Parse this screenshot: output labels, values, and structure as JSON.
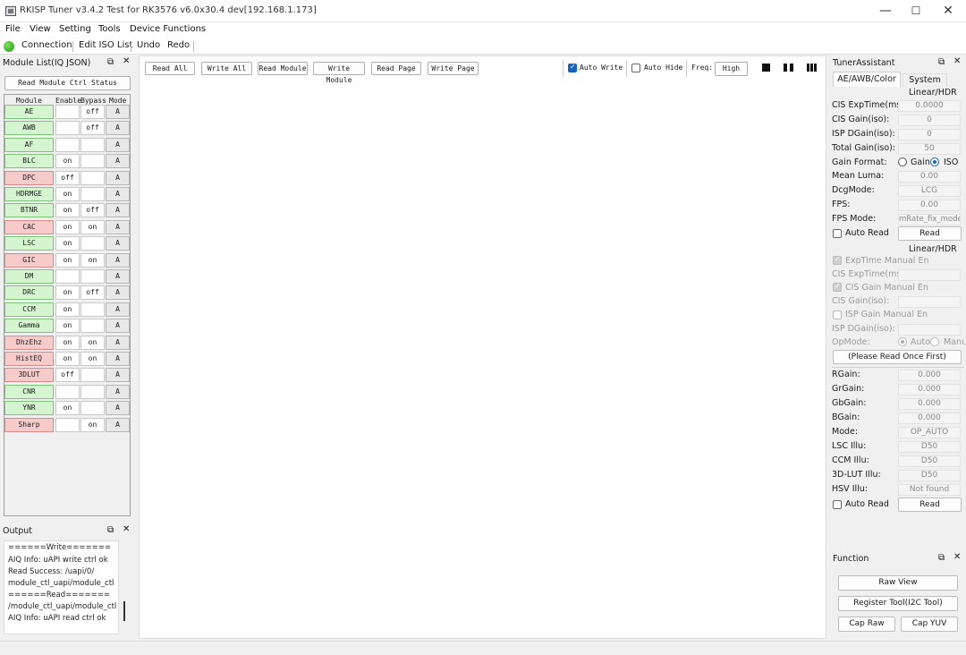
{
  "window": {
    "title": "RKISP Tuner v3.4.2 Test for RK3576 v6.0x30.4 dev[192.168.1.173]",
    "minimize": "—",
    "maximize": "☐",
    "close": "✕"
  },
  "menu": [
    "File",
    "View",
    "Setting",
    "Tools",
    "Device Functions"
  ],
  "toolbar": {
    "connection": "Connection",
    "edit_iso": "Edit ISO List",
    "undo": "Undo",
    "redo": "Redo"
  },
  "module_list": {
    "title": "Module List(IQ JSON)",
    "read_status": "Read Module Ctrl Status",
    "headers": [
      "Module",
      "Enable",
      "Bypass",
      "Mode"
    ],
    "rows": [
      {
        "name": "AE",
        "enable": "",
        "bypass": "off",
        "mode": "A",
        "status": "green"
      },
      {
        "name": "AWB",
        "enable": "",
        "bypass": "off",
        "mode": "A",
        "status": "green"
      },
      {
        "name": "AF",
        "enable": "",
        "bypass": "",
        "mode": "A",
        "status": "green"
      },
      {
        "name": "BLC",
        "enable": "on",
        "bypass": "",
        "mode": "A",
        "status": "green"
      },
      {
        "name": "DPC",
        "enable": "off",
        "bypass": "",
        "mode": "A",
        "status": "red"
      },
      {
        "name": "HDRMGE",
        "enable": "on",
        "bypass": "",
        "mode": "A",
        "status": "green"
      },
      {
        "name": "BTNR",
        "enable": "on",
        "bypass": "off",
        "mode": "A",
        "status": "green"
      },
      {
        "name": "CAC",
        "enable": "on",
        "bypass": "on",
        "mode": "A",
        "status": "red"
      },
      {
        "name": "LSC",
        "enable": "on",
        "bypass": "",
        "mode": "A",
        "status": "green"
      },
      {
        "name": "GIC",
        "enable": "on",
        "bypass": "on",
        "mode": "A",
        "status": "red"
      },
      {
        "name": "DM",
        "enable": "",
        "bypass": "",
        "mode": "A",
        "status": "green"
      },
      {
        "name": "DRC",
        "enable": "on",
        "bypass": "off",
        "mode": "A",
        "status": "green"
      },
      {
        "name": "CCM",
        "enable": "on",
        "bypass": "",
        "mode": "A",
        "status": "green"
      },
      {
        "name": "Gamma",
        "enable": "on",
        "bypass": "",
        "mode": "A",
        "status": "green"
      },
      {
        "name": "DhzEhz",
        "enable": "on",
        "bypass": "on",
        "mode": "A",
        "status": "red"
      },
      {
        "name": "HistEQ",
        "enable": "on",
        "bypass": "on",
        "mode": "A",
        "status": "red"
      },
      {
        "name": "3DLUT",
        "enable": "off",
        "bypass": "",
        "mode": "A",
        "status": "red"
      },
      {
        "name": "CNR",
        "enable": "",
        "bypass": "",
        "mode": "A",
        "status": "green"
      },
      {
        "name": "YNR",
        "enable": "on",
        "bypass": "",
        "mode": "A",
        "status": "green"
      },
      {
        "name": "Sharp",
        "enable": "",
        "bypass": "on",
        "mode": "A",
        "status": "red"
      }
    ]
  },
  "output": {
    "title": "Output",
    "lines": [
      "======Write=======",
      "AIQ Info: uAPI write ctrl ok",
      "Read Success: /uapi/0/",
      "module_ctl_uapi/module_ctl",
      "======Read=======",
      "/module_ctl_uapi/module_ctl",
      "AIQ Info: uAPI read ctrl ok"
    ]
  },
  "center": {
    "read_all": "Read All",
    "write_all": "Write All",
    "read_module": "Read Module",
    "write_module": "Write Module",
    "read_page": "Read Page",
    "write_page": "Write Page",
    "auto_write": "Auto Write",
    "auto_hide": "Auto Hide",
    "freq_label": "Freq:",
    "freq_value": "High"
  },
  "tuner": {
    "title": "TunerAssistant",
    "tabs": [
      "AE/AWB/Color",
      "System"
    ],
    "section1": "Linear/HDR",
    "fields1": [
      {
        "label": "CIS ExpTime(ms):",
        "value": "0.0000"
      },
      {
        "label": "CIS Gain(iso):",
        "value": "0"
      },
      {
        "label": "ISP DGain(iso):",
        "value": "0"
      },
      {
        "label": "Total Gain(iso):",
        "value": "50"
      }
    ],
    "gain_format": "Gain Format:",
    "gain": "Gain",
    "iso": "ISO",
    "fields2": [
      {
        "label": "Mean Luma:",
        "value": "0.00"
      },
      {
        "label": "DcgMode:",
        "value": "LCG"
      },
      {
        "label": "FPS:",
        "value": "0.00"
      }
    ],
    "fps_mode": "FPS Mode:",
    "fps_mode_value": "mRate_fix_mode",
    "auto_read": "Auto Read",
    "read": "Read",
    "section2": "Linear/HDR",
    "exp_manual": "ExpTime Manual En",
    "cis_exp": "CIS ExpTime(ms):",
    "gain_manual": "CIS Gain Manual En",
    "cis_gain": "CIS Gain(iso):",
    "isp_manual": "ISP Gain Manual En",
    "isp_dgain": "ISP DGain(iso):",
    "opmode": "OpMode:",
    "auto": "Auto",
    "manu": "Manu",
    "please_read": "(Please Read Once First)",
    "fields3": [
      {
        "label": "RGain:",
        "value": "0.000"
      },
      {
        "label": "GrGain:",
        "value": "0.000"
      },
      {
        "label": "GbGain:",
        "value": "0.000"
      },
      {
        "label": "BGain:",
        "value": "0.000"
      },
      {
        "label": "Mode:",
        "value": "OP_AUTO"
      },
      {
        "label": "LSC Illu:",
        "value": "D50"
      },
      {
        "label": "CCM Illu:",
        "value": "D50"
      },
      {
        "label": "3D-LUT Illu:",
        "value": "D50"
      },
      {
        "label": "HSV Illu:",
        "value": "Not found"
      }
    ],
    "auto_read2": "Auto Read",
    "read2": "Read"
  },
  "function": {
    "title": "Function",
    "raw_view": "Raw View",
    "register_tool": "Register Tool(I2C Tool)",
    "cap_raw": "Cap Raw",
    "cap_yuv": "Cap YUV"
  }
}
